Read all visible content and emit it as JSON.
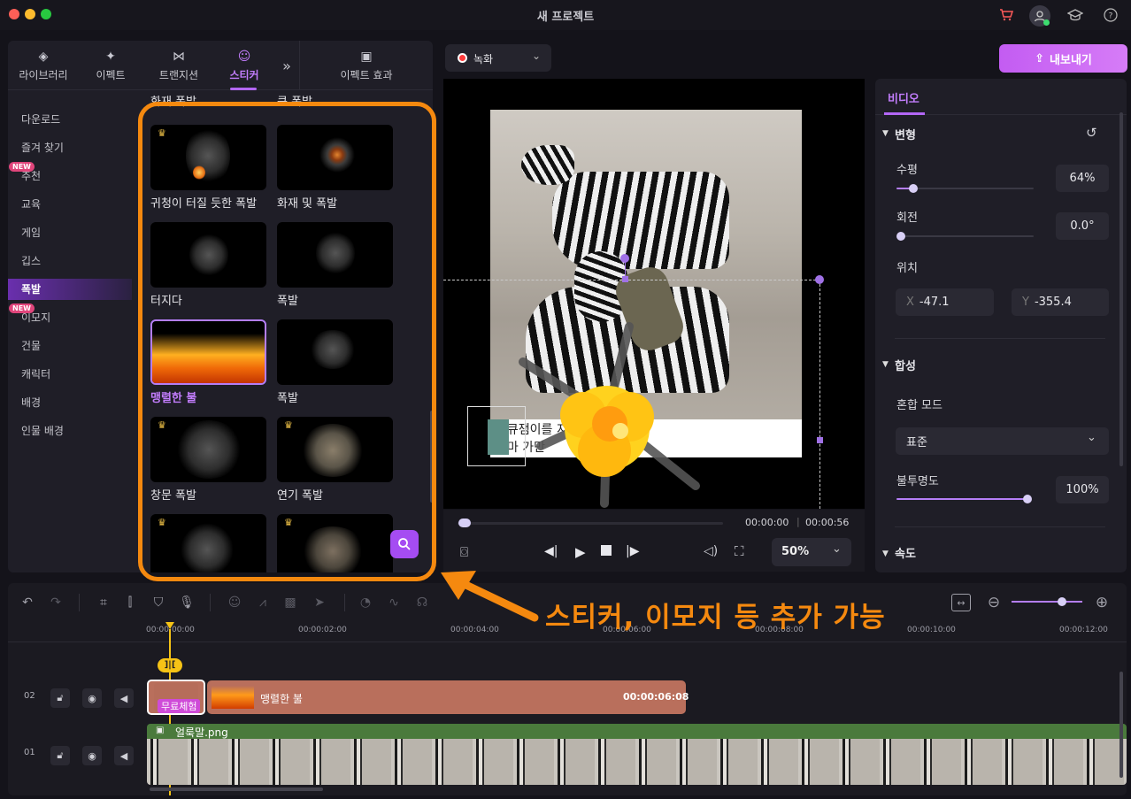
{
  "window": {
    "title": "새 프로젝트"
  },
  "tabs": [
    {
      "label": "라이브러리",
      "icon": "layers-icon"
    },
    {
      "label": "이펙트",
      "icon": "sparkle-icon"
    },
    {
      "label": "트랜지션",
      "icon": "transition-icon"
    },
    {
      "label": "스티커",
      "icon": "sticker-icon",
      "active": true
    },
    {
      "label": "이펙트 효과",
      "icon": "store-icon"
    }
  ],
  "categories": [
    {
      "label": "다운로드"
    },
    {
      "label": "즐겨 찾기"
    },
    {
      "label": "추천",
      "badge": "NEW"
    },
    {
      "label": "교육"
    },
    {
      "label": "게임"
    },
    {
      "label": "깁스"
    },
    {
      "label": "폭발",
      "active": true
    },
    {
      "label": "이모지",
      "badge": "NEW"
    },
    {
      "label": "건물"
    },
    {
      "label": "캐릭터"
    },
    {
      "label": "배경"
    },
    {
      "label": "인물 배경"
    }
  ],
  "grid_header": [
    "화재 폭발",
    "큰 폭발"
  ],
  "stickers": [
    {
      "label": "귀청이 터질 듯한 폭발",
      "premium": true
    },
    {
      "label": "화재 및 폭발",
      "premium": false
    },
    {
      "label": "터지다",
      "premium": false
    },
    {
      "label": "폭발",
      "premium": false
    },
    {
      "label": "맹렬한 불",
      "premium": false,
      "selected": true
    },
    {
      "label": "폭발",
      "premium": false
    },
    {
      "label": "창문 폭발",
      "premium": true
    },
    {
      "label": "연기 폭발",
      "premium": true
    },
    {
      "label": "",
      "premium": true
    },
    {
      "label": "",
      "premium": true
    }
  ],
  "preview": {
    "record_label": "녹화",
    "caption_line1": "다큐잼이를 지 말랬지",
    "caption_line2": "독마 가만 ",
    "time_current": "00:00:00",
    "time_total": "00:00:56",
    "zoom": "50%"
  },
  "export_label": "내보내기",
  "right": {
    "tab": "비디오",
    "transform": "변형",
    "scale_label": "수평",
    "scale_value": "64%",
    "scale_level": 0.12,
    "rotate_label": "회전",
    "rotate_value": "0.0°",
    "position_label": "위치",
    "pos_x_prefix": "X",
    "pos_x": "-47.1",
    "pos_y_prefix": "Y",
    "pos_y": "-355.4",
    "composite": "합성",
    "blend_label": "혼합 모드",
    "blend_value": "표준",
    "opacity_label": "불투명도",
    "opacity_value": "100%",
    "opacity_level": 1.0,
    "speed": "속도"
  },
  "timeline": {
    "ruler": [
      "00:00:00:00",
      "00:00:02:00",
      "00:00:04:00",
      "00:00:06:00",
      "00:00:08:00",
      "00:00:10:00",
      "00:00:12:00"
    ],
    "playhead_tag": "]|[",
    "track2": {
      "num": "02",
      "clip_label": "맹렬한 불",
      "clip_duration": "00:00:06:08",
      "trial_label": "무료체험"
    },
    "track1": {
      "num": "01",
      "clip_label": "얼룩말.png"
    }
  },
  "annotation": "스티커, 이모지 등 추가 가능",
  "colors": {
    "accent": "#b367f6",
    "annotation": "#f5890f",
    "export": "#c35cf2"
  }
}
